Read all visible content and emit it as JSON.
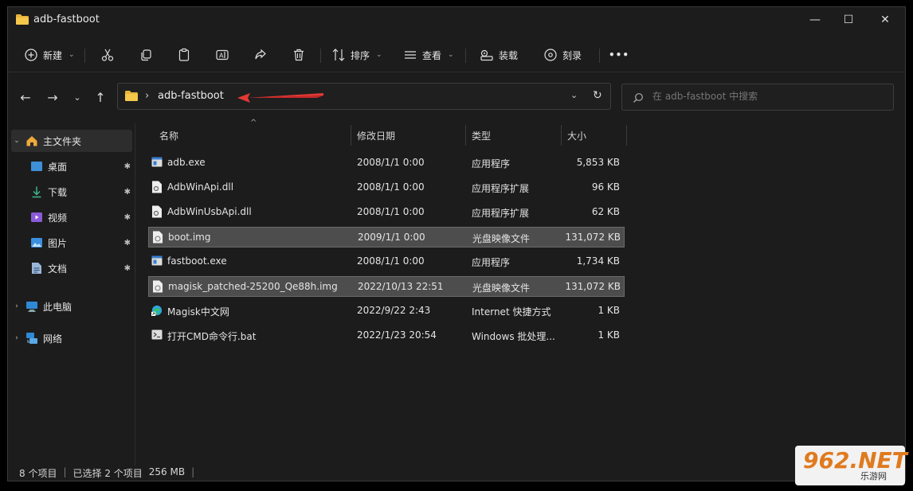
{
  "window": {
    "title": "adb-fastboot"
  },
  "toolbar": {
    "new_label": "新建",
    "sort_label": "排序",
    "view_label": "查看",
    "mount_label": "装载",
    "burn_label": "刻录",
    "more_label": "•••"
  },
  "address": {
    "path": "adb-fastboot"
  },
  "search": {
    "placeholder": "在 adb-fastboot 中搜索"
  },
  "sidebar": {
    "home": "主文件夹",
    "items": [
      {
        "label": "桌面"
      },
      {
        "label": "下载"
      },
      {
        "label": "视频"
      },
      {
        "label": "图片"
      },
      {
        "label": "文档"
      }
    ],
    "this_pc": "此电脑",
    "network": "网络"
  },
  "columns": {
    "name": "名称",
    "date": "修改日期",
    "type": "类型",
    "size": "大小"
  },
  "files": [
    {
      "name": "adb.exe",
      "date": "2008/1/1 0:00",
      "type": "应用程序",
      "size": "5,853 KB"
    },
    {
      "name": "AdbWinApi.dll",
      "date": "2008/1/1 0:00",
      "type": "应用程序扩展",
      "size": "96 KB"
    },
    {
      "name": "AdbWinUsbApi.dll",
      "date": "2008/1/1 0:00",
      "type": "应用程序扩展",
      "size": "62 KB"
    },
    {
      "name": "boot.img",
      "date": "2009/1/1 0:00",
      "type": "光盘映像文件",
      "size": "131,072 KB"
    },
    {
      "name": "fastboot.exe",
      "date": "2008/1/1 0:00",
      "type": "应用程序",
      "size": "1,734 KB"
    },
    {
      "name": "magisk_patched-25200_Qe88h.img",
      "date": "2022/10/13 22:51",
      "type": "光盘映像文件",
      "size": "131,072 KB"
    },
    {
      "name": "Magisk中文网",
      "date": "2022/9/22 2:43",
      "type": "Internet 快捷方式",
      "size": "1 KB"
    },
    {
      "name": "打开CMD命令行.bat",
      "date": "2022/1/23 20:54",
      "type": "Windows 批处理...",
      "size": "1 KB"
    }
  ],
  "status": {
    "count": "8 个项目",
    "selected": "已选择 2 个项目",
    "size": "256 MB"
  },
  "watermark": {
    "big": "962.NET",
    "small": "乐游网"
  },
  "colors": {
    "folder": "#e8b43a",
    "selection": "#4d4d4d",
    "arrow": "#e53935"
  }
}
